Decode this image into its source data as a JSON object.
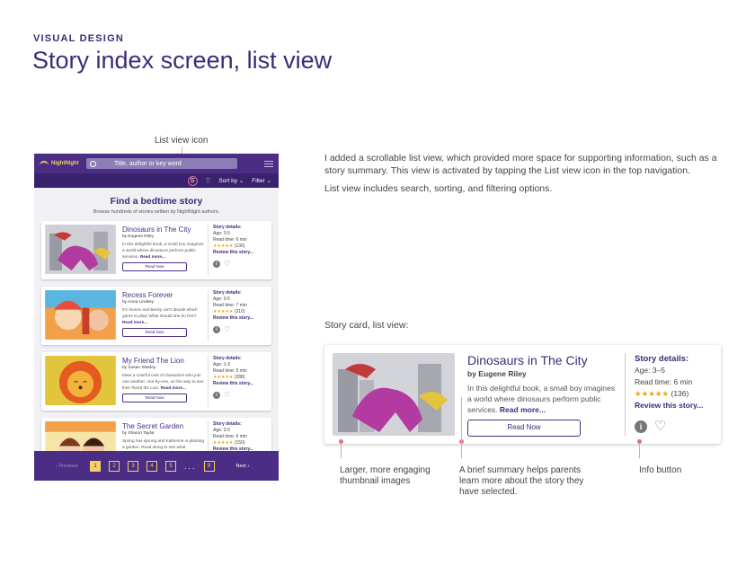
{
  "header": {
    "eyebrow": "VISUAL DESIGN",
    "title": "Story index screen, list view"
  },
  "callouts": {
    "list_view_icon": "List view icon",
    "story_card_caption": "Story card, list view:",
    "thumbnail_note": "Larger, more engaging thumbnail images",
    "summary_note": "A brief summary helps parents learn more about the story they have selected.",
    "info_note": "Info button"
  },
  "description": [
    "I added a scrollable list view, which provided more space for supporting information, such as a story summary. This view is activated by tapping the List view icon in the top navigation.",
    "List view includes search, sorting, and filtering options."
  ],
  "app": {
    "logo": "NightNight",
    "search_placeholder": "Title, author or key word",
    "sort_label": "Sort by",
    "filter_label": "Filter",
    "heading": "Find a bedtime story",
    "subheading": "Browse hundreds of stories written by NightNight authors.",
    "read_now": "Read Now",
    "details_heading": "Story details:",
    "review_link": "Review this story...",
    "read_more": "Read more...",
    "stories": [
      {
        "title": "Dinosaurs in The City",
        "author": "by Eugene Riley",
        "summary": "In this delightful book, a small boy imagines a world where dinosaurs perform public services.",
        "age": "Age: 3-5",
        "read_time": "Read time: 6 min",
        "rating": "★★★★★",
        "reviews": "(136)"
      },
      {
        "title": "Recess Forever",
        "author": "by Anna Lindsey",
        "summary": "It's recess and Becky can't decide which game to play! What should she do first?",
        "age": "Age: 3-5",
        "read_time": "Read time: 7 min",
        "rating": "★★★★★",
        "reviews": "(310)"
      },
      {
        "title": "My Friend The Lion",
        "author": "by Susan Stanley",
        "summary": "Meet a colorful cast of characters who join one another, one-by-one, on the way to see their friend the Lion.",
        "age": "Age: 1-3",
        "read_time": "Read time: 5 min",
        "rating": "★★★★★",
        "reviews": "(288)"
      },
      {
        "title": "The Secret Garden",
        "author": "by Sharon Taylor",
        "summary": "Spring has sprung and Katherine is planting a garden. Read along to see what",
        "age": "Age: 3-5",
        "read_time": "Read time: 6 min",
        "rating": "★★★★★",
        "reviews": "(150)"
      }
    ],
    "pager": {
      "prev": "Previous",
      "next": "Next",
      "pages": [
        "1",
        "2",
        "3",
        "4",
        "5",
        "9"
      ],
      "dots": "..."
    }
  },
  "card": {
    "title": "Dinosaurs in The City",
    "author": "by Eugene Riley",
    "summary": "In this delightful book, a small boy imagines a world where dinosaurs perform public services.",
    "read_more": "Read more...",
    "read_now": "Read Now",
    "details_heading": "Story details:",
    "age": "Age: 3–5",
    "read_time": "Read time: 6 min",
    "rating": "★★★★★",
    "reviews": "(136)",
    "review_link": "Review this story..."
  },
  "colors": {
    "brand": "#4b2d85",
    "accent": "#f3d060",
    "callout": "#e86a8e"
  }
}
